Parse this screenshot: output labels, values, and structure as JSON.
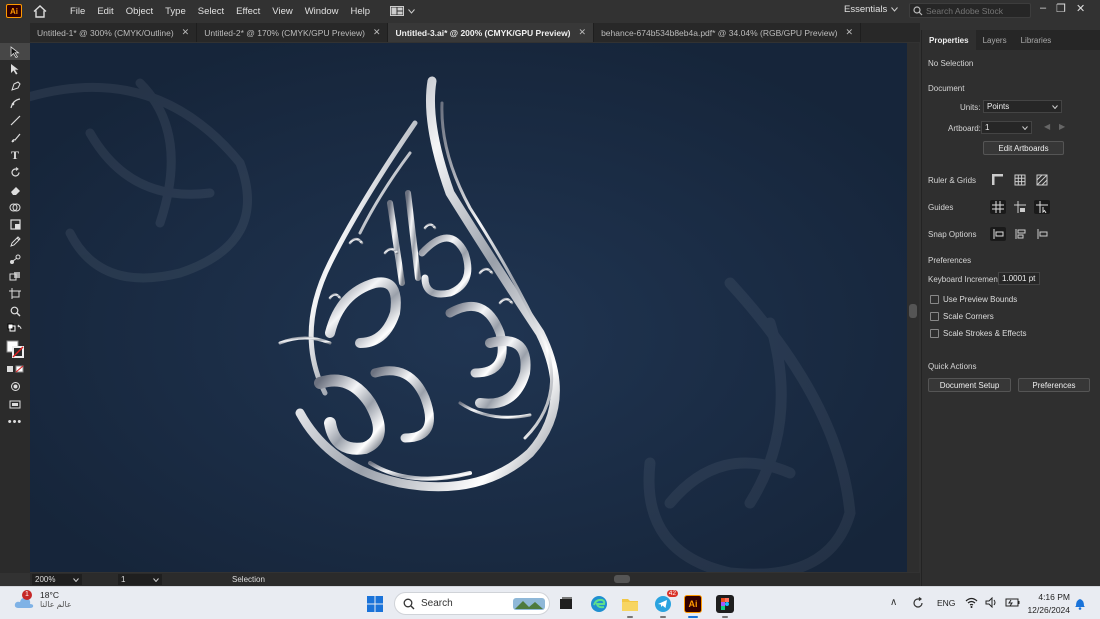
{
  "app": {
    "logo": "Ai",
    "brand_color": "#ff9a00"
  },
  "menu": [
    "File",
    "Edit",
    "Object",
    "Type",
    "Select",
    "Effect",
    "View",
    "Window",
    "Help"
  ],
  "workspace": "Essentials",
  "search_stock": {
    "placeholder": "Search Adobe Stock"
  },
  "tabs": [
    {
      "label": "Untitled-1* @ 300% (CMYK/Outline)",
      "active": false
    },
    {
      "label": "Untitled-2* @ 170% (CMYK/GPU Preview)",
      "active": false
    },
    {
      "label": "Untitled-3.ai* @ 200% (CMYK/GPU Preview)",
      "active": true
    },
    {
      "label": "behance-674b534b8eb4a.pdf* @ 34.04% (RGB/GPU Preview)",
      "active": false
    }
  ],
  "status": {
    "zoom": "200%",
    "artboard": "1",
    "mode": "Selection"
  },
  "panel": {
    "tabs": [
      "Properties",
      "Layers",
      "Libraries"
    ],
    "selection": "No Selection",
    "document_heading": "Document",
    "units_label": "Units:",
    "units_value": "Points",
    "artboard_label": "Artboard:",
    "artboard_value": "1",
    "edit_artboards": "Edit Artboards",
    "ruler_grids": "Ruler & Grids",
    "guides": "Guides",
    "snap_options": "Snap Options",
    "preferences_heading": "Preferences",
    "keyboard_increment_label": "Keyboard Increment:",
    "keyboard_increment_value": "1.0001 pt",
    "checkboxes": [
      "Use Preview Bounds",
      "Scale Corners",
      "Scale Strokes & Effects"
    ],
    "quick_actions": "Quick Actions",
    "document_setup": "Document Setup",
    "preferences_button": "Preferences"
  },
  "taskbar": {
    "weather_temp": "18°C",
    "weather_text": "عالم عالنا",
    "weather_badge": "1",
    "search": "Search",
    "telegram_badge": "42",
    "language": "ENG",
    "time": "4:16 PM",
    "date": "12/26/2024"
  }
}
